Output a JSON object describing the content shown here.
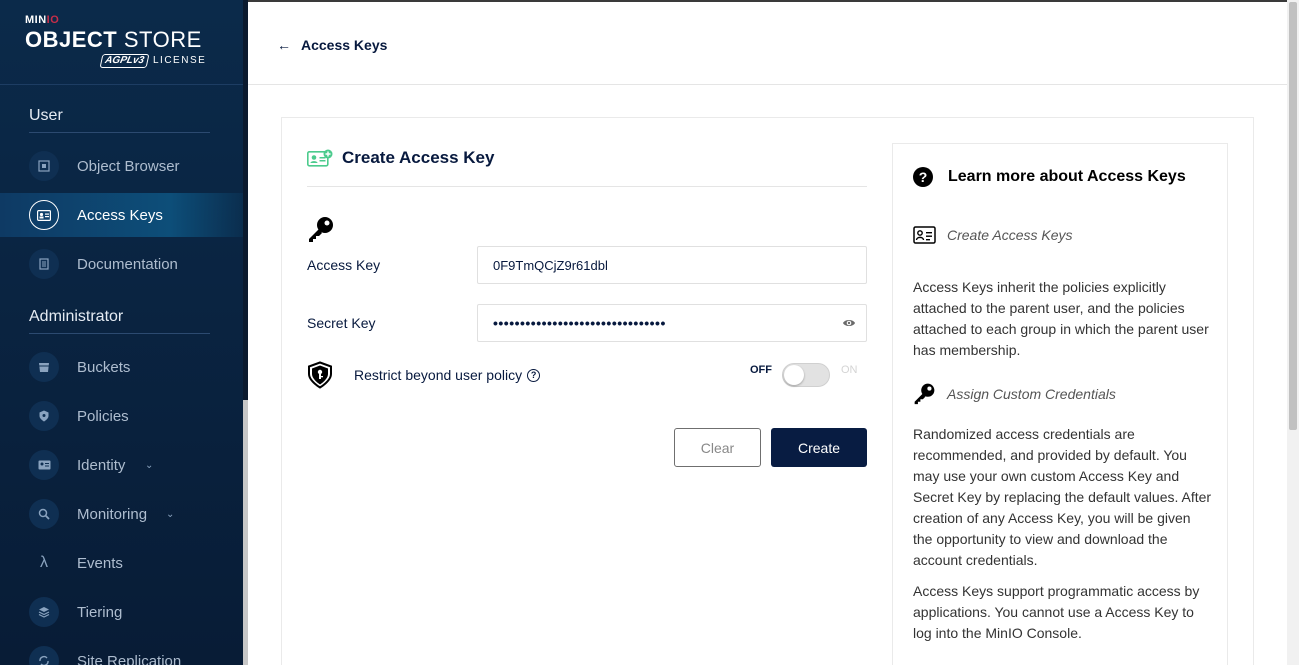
{
  "sidebar": {
    "logo": {
      "brand_prefix": "MIN",
      "brand_suffix": "IO",
      "product_bold": "OBJECT",
      "product_rest": " STORE",
      "license_badge": "AGPLv3",
      "license_text": "LICENSE"
    },
    "sections": [
      {
        "title": "User",
        "items": [
          {
            "label": "Object Browser",
            "icon": "object-browser-icon",
            "active": false
          },
          {
            "label": "Access Keys",
            "icon": "access-keys-icon",
            "active": true
          },
          {
            "label": "Documentation",
            "icon": "documentation-icon",
            "active": false
          }
        ]
      },
      {
        "title": "Administrator",
        "items": [
          {
            "label": "Buckets",
            "icon": "bucket-icon",
            "active": false
          },
          {
            "label": "Policies",
            "icon": "policy-icon",
            "active": false
          },
          {
            "label": "Identity",
            "icon": "identity-icon",
            "active": false,
            "expandable": true
          },
          {
            "label": "Monitoring",
            "icon": "monitoring-icon",
            "active": false,
            "expandable": true
          },
          {
            "label": "Events",
            "icon": "lambda-icon",
            "glyph": "λ",
            "active": false
          },
          {
            "label": "Tiering",
            "icon": "tiering-icon",
            "active": false
          },
          {
            "label": "Site Replication",
            "icon": "site-replication-icon",
            "active": false
          }
        ]
      }
    ]
  },
  "header": {
    "back_label": "Access Keys"
  },
  "form": {
    "title": "Create Access Key",
    "access_key_label": "Access Key",
    "access_key_value": "0F9TmQCjZ9r61dbl",
    "secret_key_label": "Secret Key",
    "secret_key_masked": "••••••••••••••••••••••••••••••••",
    "restrict_label": "Restrict beyond user policy",
    "toggle_off": "OFF",
    "toggle_on": "ON",
    "toggle_state": false,
    "clear_label": "Clear",
    "create_label": "Create"
  },
  "help": {
    "title": "Learn more about Access Keys",
    "create_heading": "Create Access Keys",
    "create_text": "Access Keys inherit the policies explicitly attached to the parent user, and the policies attached to each group in which the parent user has membership.",
    "assign_heading": "Assign Custom Credentials",
    "assign_text": "Randomized access credentials are recommended, and provided by default. You may use your own custom Access Key and Secret Key by replacing the default values. After creation of any Access Key, you will be given the opportunity to view and download the account credentials.",
    "support_text": "Access Keys support programmatic access by applications. You cannot use a Access Key to log into the MinIO Console."
  },
  "colors": {
    "sidebar_bg": "#081c36",
    "primary": "#081c42",
    "accent_green": "#4ccb8d"
  }
}
